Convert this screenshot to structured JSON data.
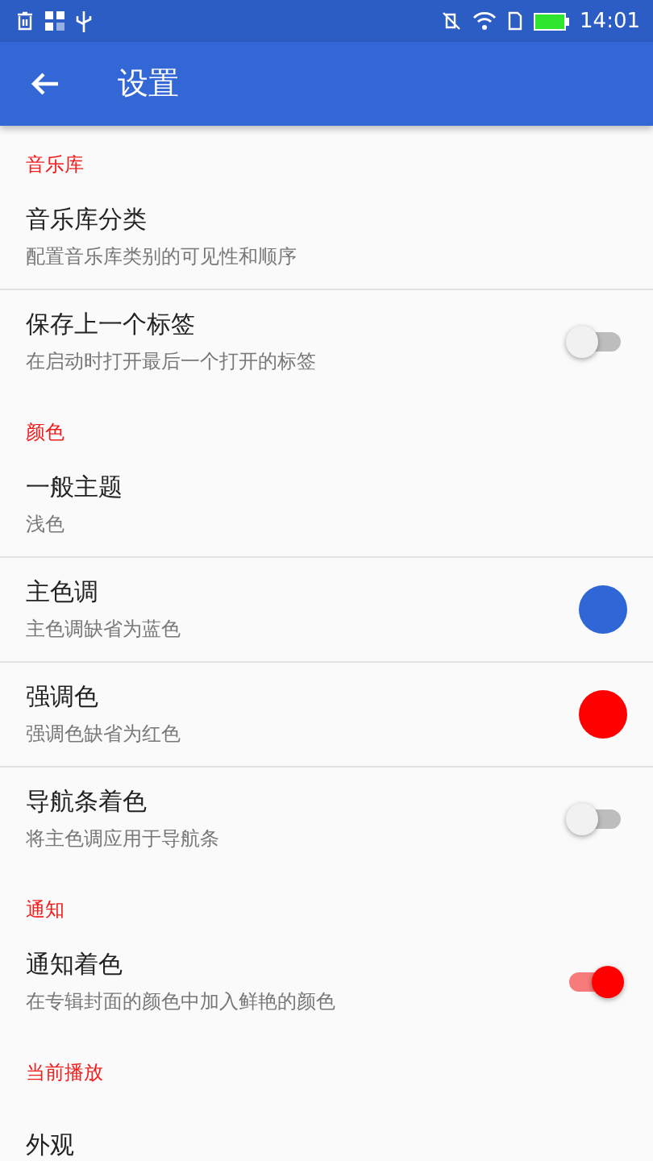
{
  "status_bar": {
    "time": "14:01"
  },
  "app_bar": {
    "title": "设置"
  },
  "sections": [
    {
      "header": "音乐库",
      "items": [
        {
          "kind": "plain",
          "title": "音乐库分类",
          "subtitle": "配置音乐库类别的可见性和顺序"
        },
        {
          "kind": "toggle",
          "title": "保存上一个标签",
          "subtitle": "在启动时打开最后一个打开的标签",
          "on": false
        }
      ]
    },
    {
      "header": "颜色",
      "items": [
        {
          "kind": "plain",
          "title": "一般主题",
          "subtitle": "浅色"
        },
        {
          "kind": "color",
          "title": "主色调",
          "subtitle": "主色调缺省为蓝色",
          "color": "#3066d6"
        },
        {
          "kind": "color",
          "title": "强调色",
          "subtitle": "强调色缺省为红色",
          "color": "#ff0000"
        },
        {
          "kind": "toggle",
          "title": "导航条着色",
          "subtitle": "将主色调应用于导航条",
          "on": false
        }
      ]
    },
    {
      "header": "通知",
      "items": [
        {
          "kind": "toggle",
          "title": "通知着色",
          "subtitle": "在专辑封面的颜色中加入鲜艳的颜色",
          "on": true
        }
      ]
    },
    {
      "header": "当前播放",
      "items": [
        {
          "kind": "plain",
          "title": "外观"
        }
      ]
    }
  ]
}
